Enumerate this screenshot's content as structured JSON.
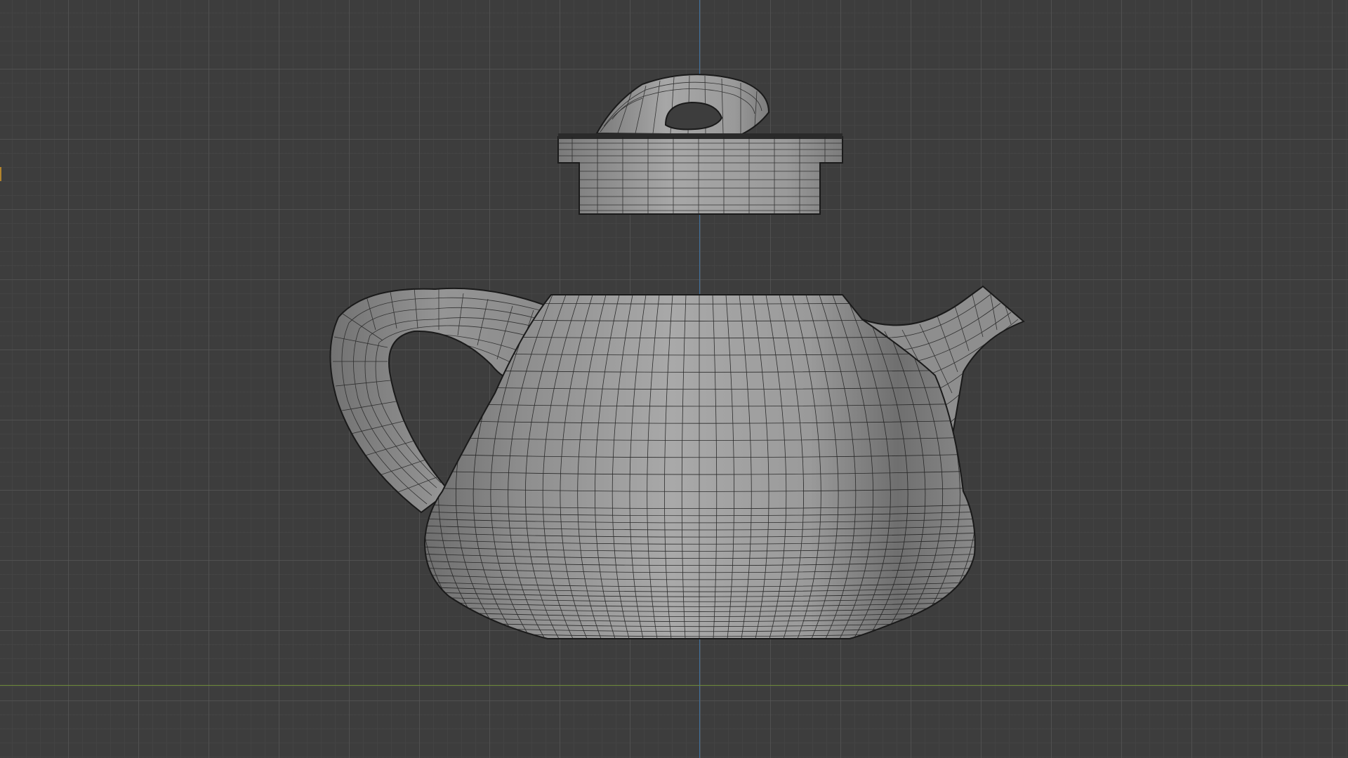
{
  "viewport": {
    "type": "3d-viewport-orthographic-front",
    "background_color": "#3d3d3d",
    "grid_minor_color": "#444444",
    "grid_major_color": "#5a5a5a",
    "axis_z_color": "#3f6f9c",
    "axis_x_color": "#6f8c3a"
  },
  "scene": {
    "objects": [
      {
        "name": "teapot-lid",
        "display": "solid-with-wireframe"
      },
      {
        "name": "teapot-body",
        "display": "solid-with-wireframe"
      }
    ],
    "mesh_color": "#9a9a9a",
    "wire_color": "#1e1e1e"
  }
}
